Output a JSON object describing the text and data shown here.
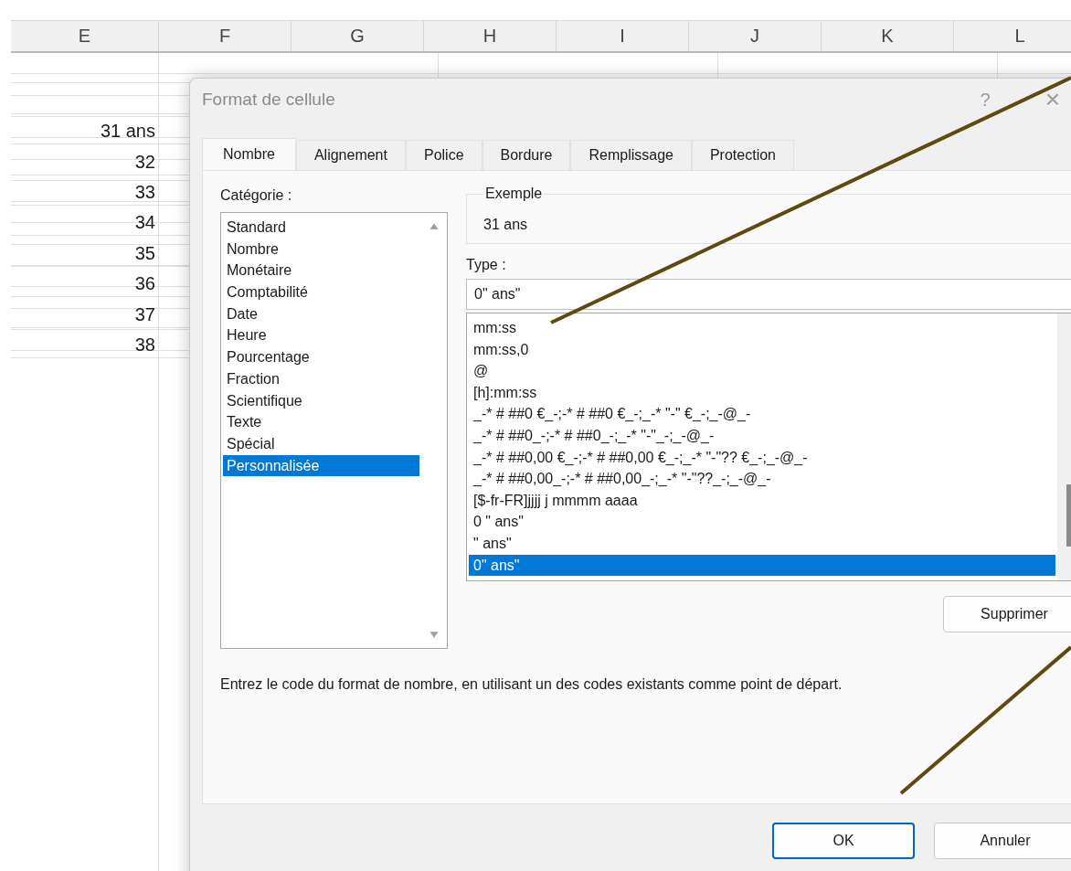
{
  "sheet": {
    "columns": [
      "E",
      "F",
      "G",
      "H",
      "I",
      "J",
      "K",
      "L"
    ],
    "cells": [
      "",
      "",
      "31 ans",
      "32",
      "33",
      "34",
      "35",
      "36",
      "37",
      "38"
    ]
  },
  "dialog": {
    "title": "Format de cellule",
    "help": "?",
    "close": "×",
    "tabs": [
      {
        "label": "Nombre",
        "selected": true
      },
      {
        "label": "Alignement",
        "selected": false
      },
      {
        "label": "Police",
        "selected": false
      },
      {
        "label": "Bordure",
        "selected": false
      },
      {
        "label": "Remplissage",
        "selected": false
      },
      {
        "label": "Protection",
        "selected": false
      }
    ],
    "category_label": "Catégorie :",
    "categories": [
      {
        "label": "Standard",
        "selected": false
      },
      {
        "label": "Nombre",
        "selected": false
      },
      {
        "label": "Monétaire",
        "selected": false
      },
      {
        "label": "Comptabilité",
        "selected": false
      },
      {
        "label": "Date",
        "selected": false
      },
      {
        "label": "Heure",
        "selected": false
      },
      {
        "label": "Pourcentage",
        "selected": false
      },
      {
        "label": "Fraction",
        "selected": false
      },
      {
        "label": "Scientifique",
        "selected": false
      },
      {
        "label": "Texte",
        "selected": false
      },
      {
        "label": "Spécial",
        "selected": false
      },
      {
        "label": "Personnalisée",
        "selected": true
      }
    ],
    "sample": {
      "label": "Exemple",
      "value": "31 ans"
    },
    "type_label": "Type :",
    "type_value": "0\" ans\"",
    "formats": [
      {
        "label": "mm:ss",
        "selected": false
      },
      {
        "label": "mm:ss,0",
        "selected": false
      },
      {
        "label": "@",
        "selected": false
      },
      {
        "label": "[h]:mm:ss",
        "selected": false
      },
      {
        "label": "_-* # ##0 €_-;-* # ##0 €_-;_-* \"-\" €_-;_-@_-",
        "selected": false
      },
      {
        "label": "_-* # ##0_-;-* # ##0_-;_-* \"-\"_-;_-@_-",
        "selected": false
      },
      {
        "label": "_-* # ##0,00 €_-;-* # ##0,00 €_-;_-* \"-\"?? €_-;_-@_-",
        "selected": false
      },
      {
        "label": "_-* # ##0,00_-;-* # ##0,00_-;_-* \"-\"??_-;_-@_-",
        "selected": false
      },
      {
        "label": "[$-fr-FR]jjjj j mmmm aaaa",
        "selected": false
      },
      {
        "label": "0 \" ans\"",
        "selected": false
      },
      {
        "label": " \" ans\"",
        "selected": false
      },
      {
        "label": "0\" ans\"",
        "selected": true
      }
    ],
    "delete_button": "Supprimer",
    "description": "Entrez le code du format de nombre, en utilisant un des codes existants comme point de départ.",
    "ok_button": "OK",
    "cancel_button": "Annuler"
  }
}
